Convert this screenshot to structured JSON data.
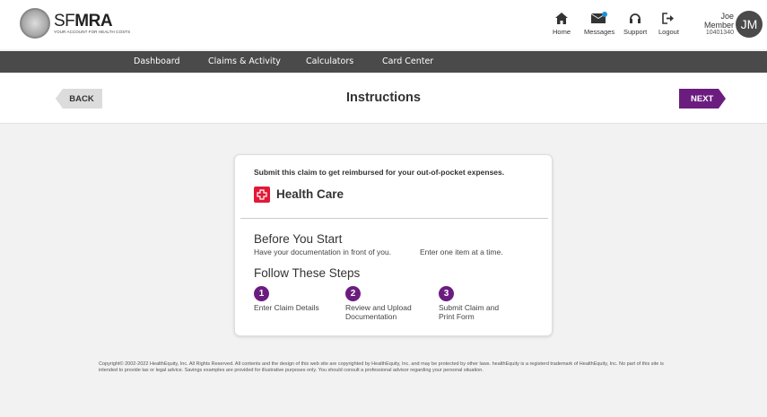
{
  "header": {
    "brand_light": "SF",
    "brand_bold": "MRA",
    "tagline": "YOUR ACCOUNT FOR HEALTH COSTS",
    "nav": [
      {
        "label": "Home",
        "icon": "home-icon"
      },
      {
        "label": "Messages",
        "icon": "messages-icon"
      },
      {
        "label": "Support",
        "icon": "headset-icon"
      },
      {
        "label": "Logout",
        "icon": "logout-icon"
      }
    ],
    "user": {
      "name": "Joe Member",
      "id": "10401340",
      "initials": "JM"
    }
  },
  "mainnav": [
    "Dashboard",
    "Claims & Activity",
    "Calculators",
    "Card Center"
  ],
  "titlebar": {
    "back": "BACK",
    "title": "Instructions",
    "next": "NEXT"
  },
  "card": {
    "intro": "Submit this claim to get reimbursed for your out-of-pocket expenses.",
    "category": "Health Care",
    "before_title": "Before You Start",
    "before_note1": "Have your documentation in front of you.",
    "before_note2": "Enter one item at a time.",
    "steps_title": "Follow These Steps",
    "steps": [
      {
        "num": "1",
        "line1": "Enter Claim Details",
        "line2": ""
      },
      {
        "num": "2",
        "line1": "Review and Upload",
        "line2": "Documentation"
      },
      {
        "num": "3",
        "line1": "Submit Claim and",
        "line2": "Print Form"
      }
    ]
  },
  "footer": "Copyright© 2002-2022 HealthEquity, Inc. All Rights Reserved. All contents and the design of this web site are copyrighted by HealthEquity, Inc. and may be protected by other laws. healthEquity is a registerd trademark of HealthEquity, Inc. No part of this site is intended to provide tax or legal advice. Savings examples are provided for illustrative purposes only. You should consult a professional advisor regarding your personal situation.",
  "colors": {
    "accent": "#6b1d7f",
    "nav_bg": "#4a4a4a",
    "health_red": "#e31837",
    "message_dot": "#1e90d6"
  }
}
